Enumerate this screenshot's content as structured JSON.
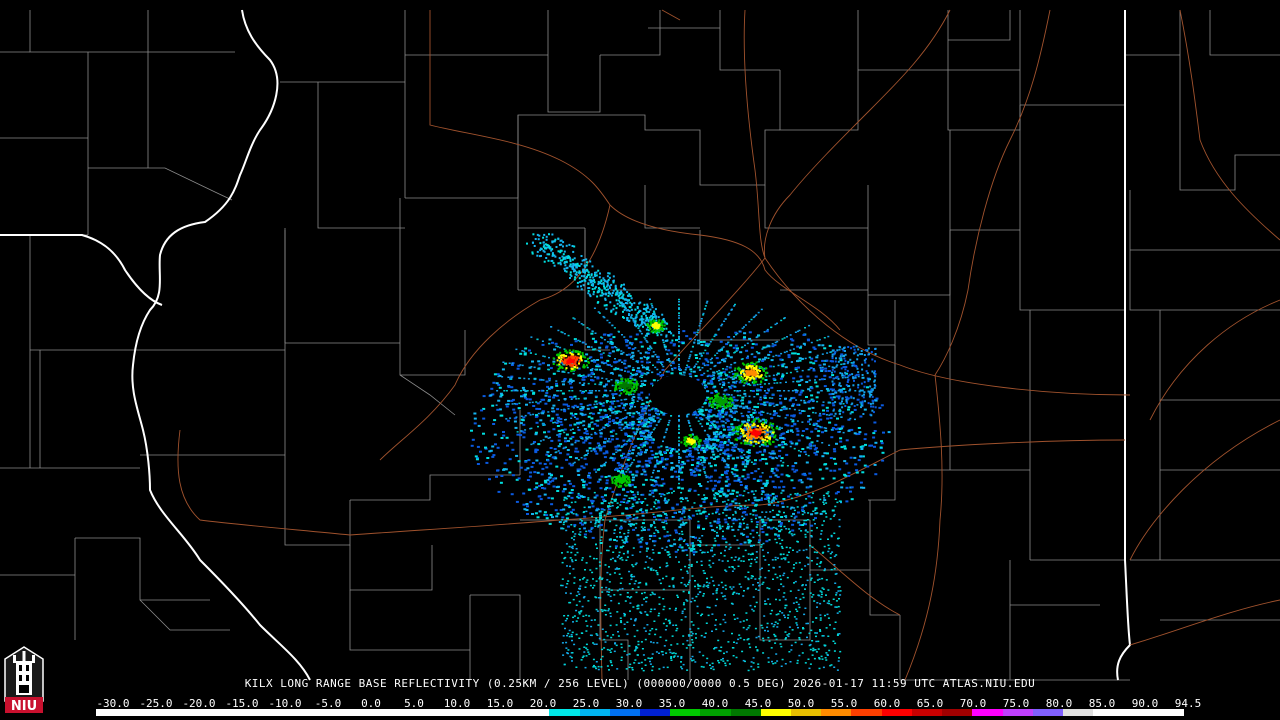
{
  "caption": "KILX LONG RANGE BASE REFLECTIVITY (0.25KM / 256 LEVEL) (000000/0000 0.5 DEG) 2026-01-17 11:59 UTC  ATLAS.NIU.EDU",
  "logo_text": "NIU",
  "colors": {
    "background": "#000000",
    "county_lines": "#8c8c8c",
    "state_lines": "#ffffff",
    "roads": "#a0522d"
  },
  "scale": {
    "labels": [
      "-30.0",
      "-25.0",
      "-20.0",
      "-15.0",
      "-10.0",
      "-5.0",
      "0.0",
      "5.0",
      "10.0",
      "15.0",
      "20.0",
      "25.0",
      "30.0",
      "35.0",
      "40.0",
      "45.0",
      "50.0",
      "55.0",
      "60.0",
      "65.0",
      "70.0",
      "75.0",
      "80.0",
      "85.0",
      "90.0",
      "94.5"
    ],
    "colors": [
      "#ffffff",
      "#ffffff",
      "#ffffff",
      "#ffffff",
      "#ffffff",
      "#ffffff",
      "#ffffff",
      "#ffffff",
      "#ffffff",
      "#ffffff",
      "#ffffff",
      "#ffffff",
      "#ffffff",
      "#ffffff",
      "#ffffff",
      "#00e8e8",
      "#00b4f0",
      "#0070f0",
      "#0020d0",
      "#00c800",
      "#00a000",
      "#007800",
      "#ffff00",
      "#e8c000",
      "#ff8c00",
      "#ff4000",
      "#ff0000",
      "#c80000",
      "#a00000",
      "#ff00ff",
      "#c040ff",
      "#8060ff",
      "#e0e0e0",
      "#ffffff",
      "#ffffff",
      "#ffffff"
    ]
  },
  "icons": {
    "logo": "niu-tower-logo-icon"
  }
}
